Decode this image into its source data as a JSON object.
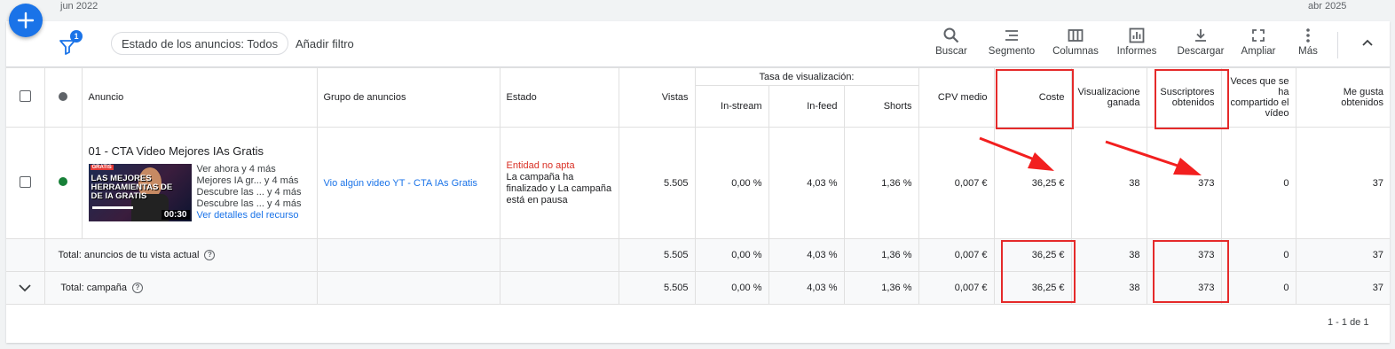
{
  "timeline": {
    "start": "jun 2022",
    "end": "abr 2025"
  },
  "toolbar": {
    "filter_badge": "1",
    "status_chip": "Estado de los anuncios: Todos",
    "add_filter": "Añadir filtro",
    "tools": [
      {
        "label": "Buscar",
        "icon": "search-icon"
      },
      {
        "label": "Segmento",
        "icon": "segment-icon"
      },
      {
        "label": "Columnas",
        "icon": "columns-icon"
      },
      {
        "label": "Informes",
        "icon": "reports-icon"
      },
      {
        "label": "Descargar",
        "icon": "download-icon"
      },
      {
        "label": "Ampliar",
        "icon": "expand-icon"
      },
      {
        "label": "Más",
        "icon": "more-vert-icon"
      }
    ]
  },
  "table": {
    "headers": {
      "ad": "Anuncio",
      "adgroup": "Grupo de anuncios",
      "status": "Estado",
      "views": "Vistas",
      "view_rate_group": "Tasa de visualización:",
      "instream": "In-stream",
      "infeed": "In-feed",
      "shorts": "Shorts",
      "cpv": "CPV medio",
      "cost": "Coste",
      "earned_views": "Visualizacione ganada",
      "subscribers": "Suscriptores obtenidos",
      "shares": "Veces que se ha compartido el vídeo",
      "likes": "Me gusta obtenidos"
    },
    "row": {
      "title": "01 - CTA Video Mejores IAs Gratis",
      "headlines": [
        {
          "text": "Ver ahora y 4 más"
        },
        {
          "text": "Mejores IA gr... y 4 más"
        },
        {
          "text": "Descubre las ... y 4 más"
        },
        {
          "text": "Descubre las ... y 4 más"
        }
      ],
      "details_link": "Ver detalles del recurso",
      "thumb": {
        "tag": "GRATIS",
        "line1": "LAS MEJORES",
        "line2": "HERRAMIENTAS DE",
        "line3": "DE IA GRATIS",
        "duration": "00:30"
      },
      "adgroup": "Vio algún video YT - CTA IAs Gratis",
      "status_title": "Entidad no apta",
      "status_detail": "La campaña ha finalizado y La campaña está en pausa",
      "views": "5.505",
      "instream": "0,00 %",
      "infeed": "4,03 %",
      "shorts": "1,36 %",
      "cpv": "0,007 €",
      "cost": "36,25 €",
      "earned_views": "38",
      "subscribers": "373",
      "shares": "0",
      "likes": "37"
    },
    "total_view": {
      "label": "Total: anuncios de tu vista actual",
      "views": "5.505",
      "instream": "0,00 %",
      "infeed": "4,03 %",
      "shorts": "1,36 %",
      "cpv": "0,007 €",
      "cost": "36,25 €",
      "earned_views": "38",
      "subscribers": "373",
      "shares": "0",
      "likes": "37"
    },
    "total_campaign": {
      "label": "Total: campaña",
      "views": "5.505",
      "instream": "0,00 %",
      "infeed": "4,03 %",
      "shorts": "1,36 %",
      "cpv": "0,007 €",
      "cost": "36,25 €",
      "earned_views": "38",
      "subscribers": "373",
      "shares": "0",
      "likes": "37"
    }
  },
  "pagination": "1 - 1 de 1",
  "colors": {
    "accent": "#1a73e8",
    "status_red": "#d93025",
    "active_green": "#188038",
    "highlight": "#e52a2a"
  }
}
